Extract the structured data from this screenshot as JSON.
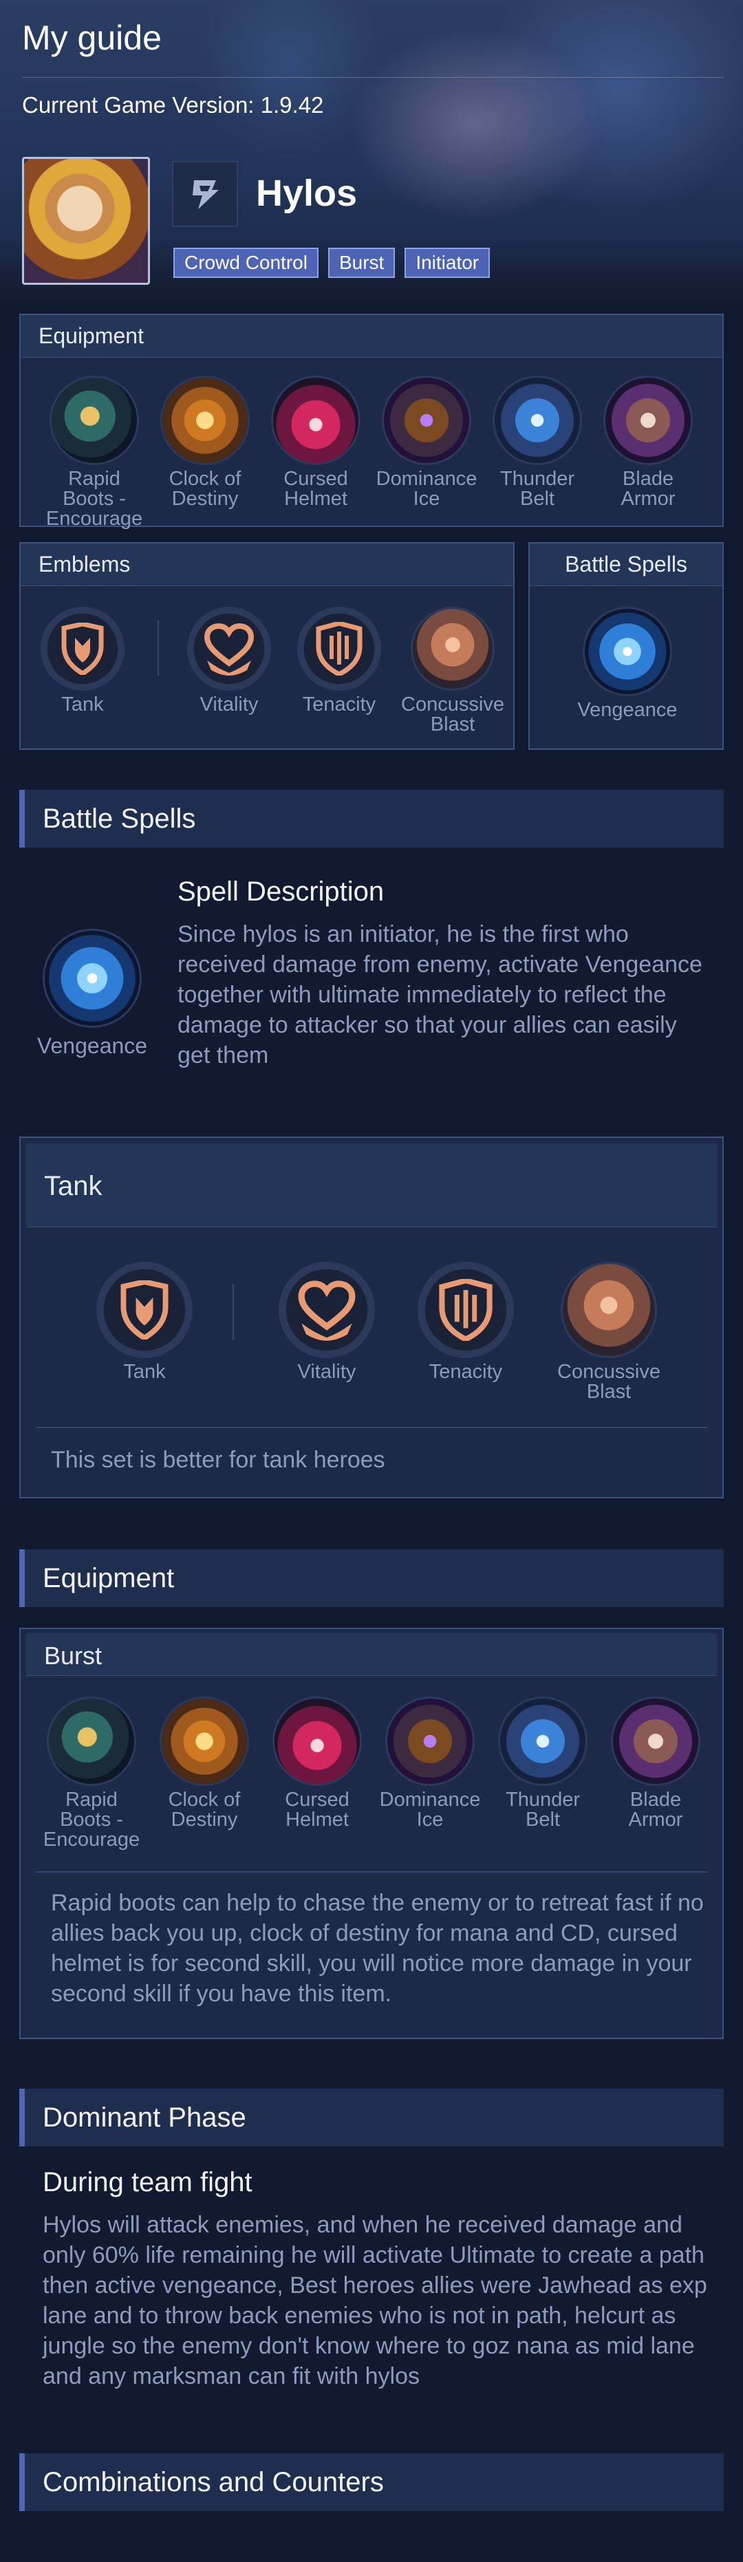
{
  "page": {
    "title": "My guide",
    "version": "Current Game Version: 1.9.42"
  },
  "hero": {
    "name": "Hylos",
    "tags": [
      "Crowd Control",
      "Burst",
      "Initiator"
    ]
  },
  "summary": {
    "equipment_title": "Equipment",
    "equipment": [
      "Rapid Boots - Encourage",
      "Clock of Destiny",
      "Cursed Helmet",
      "Dominance Ice",
      "Thunder Belt",
      "Blade Armor"
    ],
    "emblems_title": "Emblems",
    "emblem_main": "Tank",
    "emblem_talents": [
      "Vitality",
      "Tenacity",
      "Concussive Blast"
    ],
    "spells_title": "Battle Spells",
    "spell": "Vengeance"
  },
  "battle_spells": {
    "section_title": "Battle Spells",
    "spell": "Vengeance",
    "desc_title": "Spell Description",
    "description": "Since hylos is an initiator, he is the first who received damage from enemy, activate Vengeance together with ultimate immediately to reflect the damage to attacker so that your allies can easily get them"
  },
  "emblem_card": {
    "title": "Tank",
    "main": "Tank",
    "talents": [
      "Vitality",
      "Tenacity",
      "Concussive Blast"
    ],
    "note": "This set is better for tank heroes"
  },
  "equipment_section": {
    "section_title": "Equipment",
    "build_title": "Burst",
    "items": [
      "Rapid Boots - Encourage",
      "Clock of Destiny",
      "Cursed Helmet",
      "Dominance Ice",
      "Thunder Belt",
      "Blade Armor"
    ],
    "note": "Rapid boots can help to chase the enemy or to retreat fast if no allies back you up, clock of destiny for mana and CD, cursed helmet is for second skill, you will notice more damage in your second skill if you have this item."
  },
  "dominant_phase": {
    "section_title": "Dominant Phase",
    "sub_title": "During team fight",
    "text": "Hylos will attack enemies, and when he received damage and only 60% life remaining he will activate Ultimate to create a path then active vengeance, Best heroes allies were Jawhead as exp lane and to throw back enemies who is not in path, helcurt as jungle so the enemy don't know where to goz nana as mid lane and any marksman can fit with hylos"
  },
  "combos": {
    "section_title": "Combinations and Counters"
  },
  "icons": {
    "class_icon": "tank-class-icon",
    "equipment": [
      "boots-icon",
      "clock-icon",
      "helmet-icon",
      "ice-icon",
      "belt-icon",
      "armor-icon"
    ],
    "emblem_main": "shield-emblem-icon",
    "talents": [
      "heart-icon",
      "tenacity-shield-icon",
      "blast-icon"
    ],
    "spell": "vengeance-icon"
  },
  "colors": {
    "background": "#111a2e",
    "panel": "#1c2a47",
    "accent": "#4f66b8",
    "tag": "#4d63b4",
    "muted_text": "#8e9cbc",
    "emblem_orange": "#e89a72"
  }
}
